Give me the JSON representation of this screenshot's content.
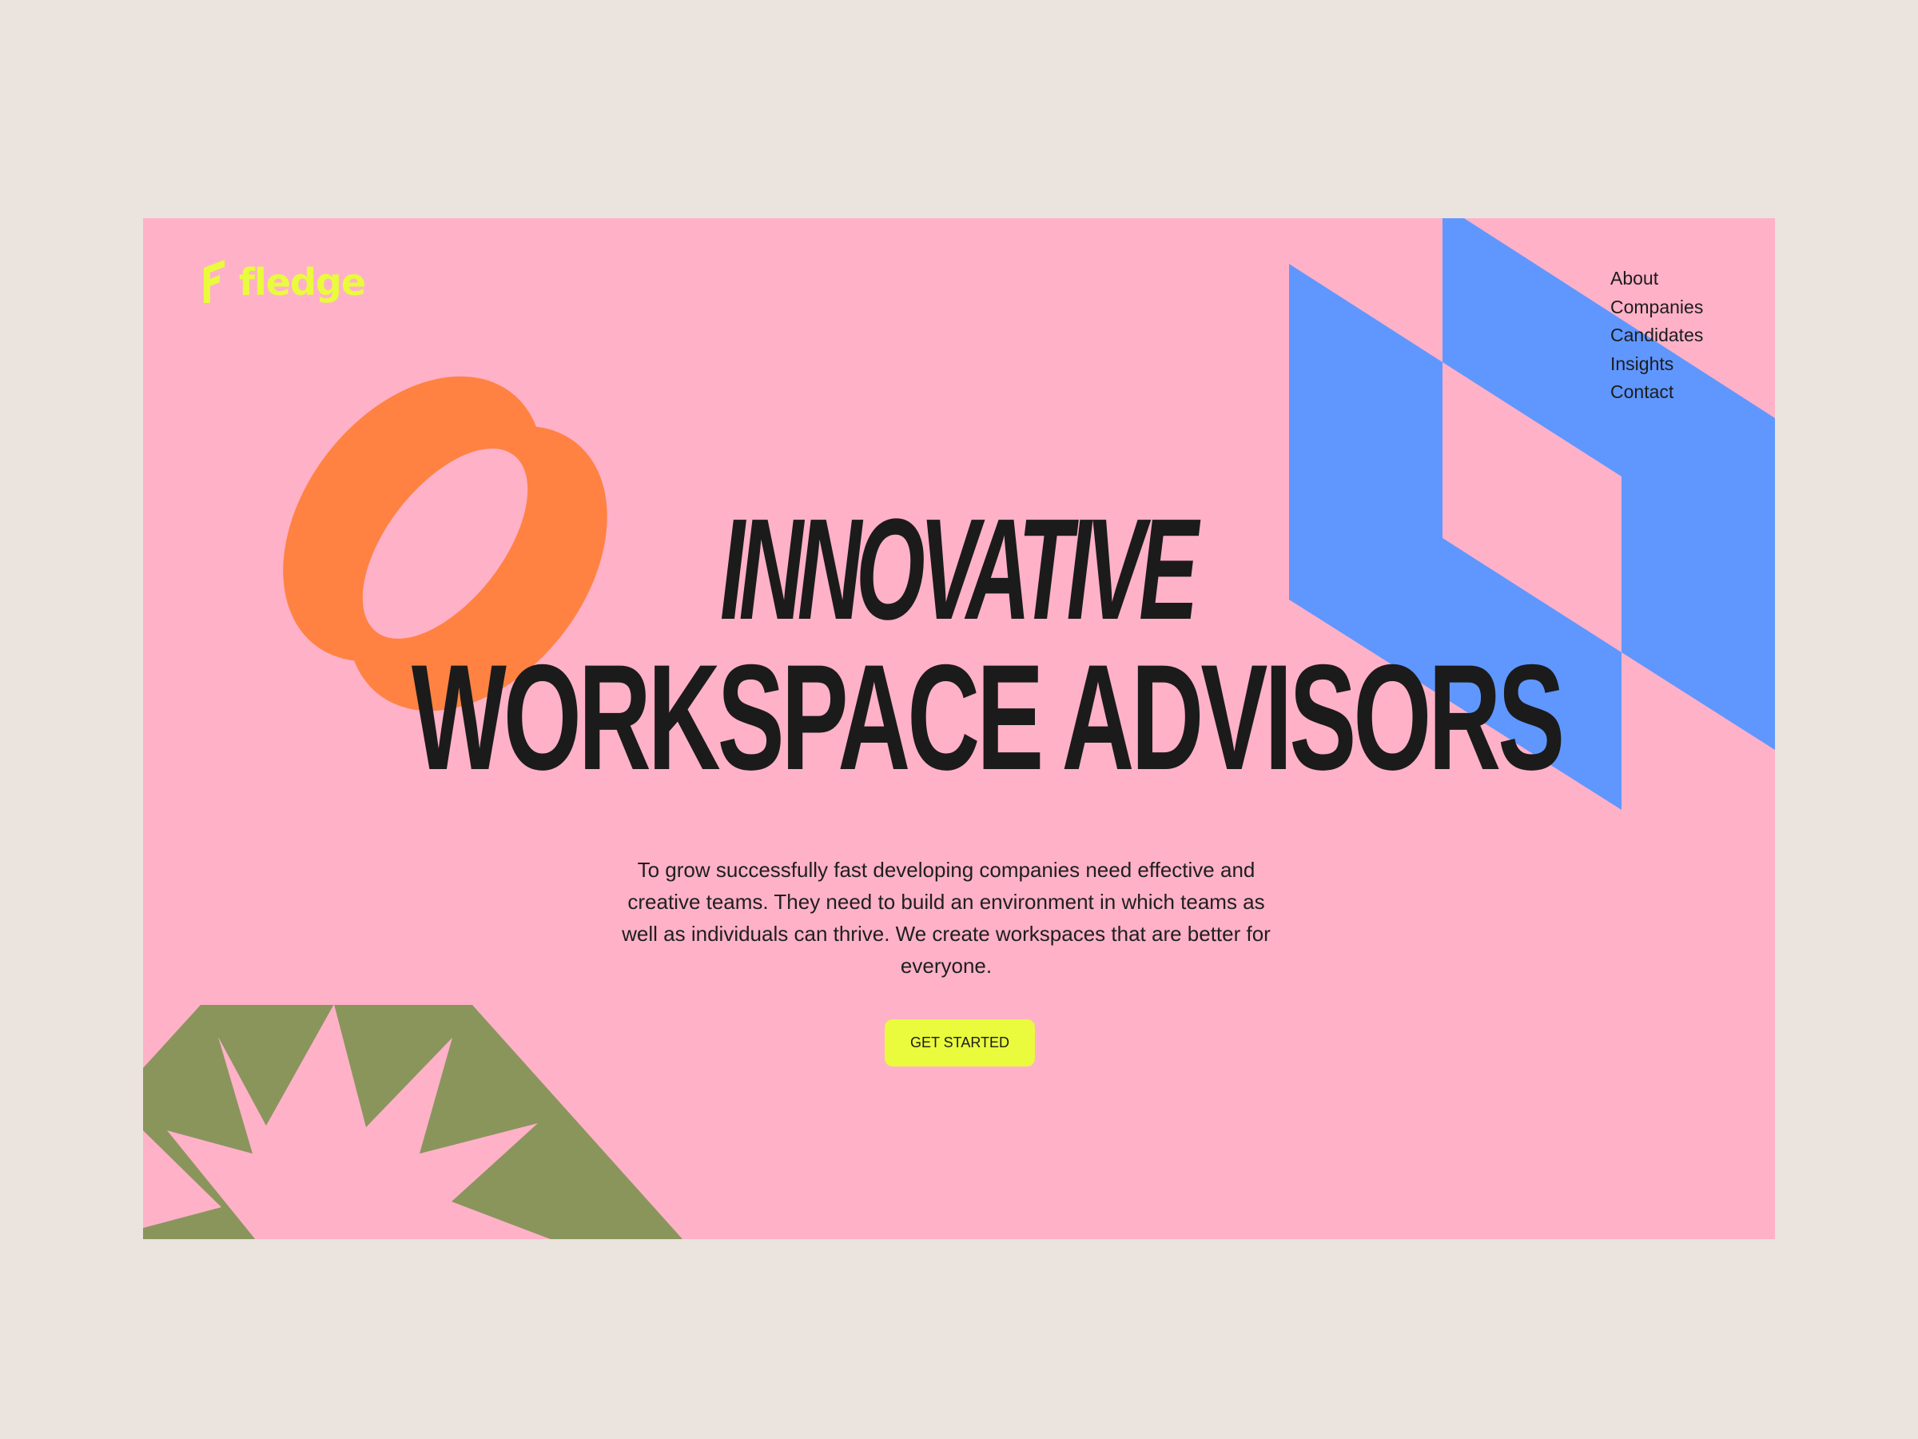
{
  "brand": {
    "name": "fledge",
    "logo_icon": "fledge-f-mark-icon"
  },
  "nav": {
    "items": [
      "About",
      "Companies",
      "Candidates",
      "Insights",
      "Contact"
    ]
  },
  "hero": {
    "headline_line1": "INNOVATIVE",
    "headline_line2": "WORKSPACE ADVISORS",
    "description": "To grow successfully fast developing companies need effective and creative teams. They need to build an environment in which teams as well as individuals can thrive. We create workspaces that are better for everyone.",
    "cta_label": "GET STARTED"
  },
  "decor": {
    "shapes": [
      "orange-interlocking-ovals",
      "blue-geometric-block",
      "olive-starburst-shape"
    ]
  },
  "colors": {
    "page_background": "#ebe3dd",
    "hero_background": "#ffb1c8",
    "accent_yellow": "#e9fb3c",
    "orange": "#ff8242",
    "blue": "#5f97ff",
    "olive": "#8a955c",
    "text_dark": "#1b1b1b"
  }
}
